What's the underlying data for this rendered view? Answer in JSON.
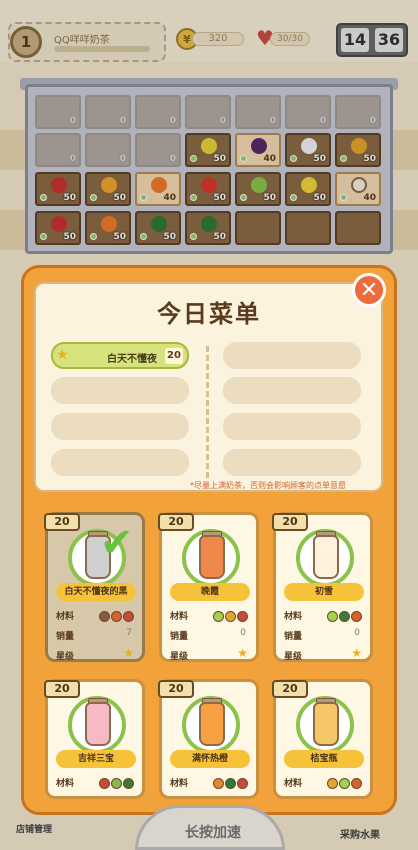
{
  "top": {
    "level": "1",
    "name": "QQ咩咩奶茶",
    "coins": "320",
    "hearts": "30/30",
    "clock_h": "14",
    "clock_m": "36"
  },
  "shelf": {
    "row1": [
      "0",
      "0",
      "0",
      "0",
      "0",
      "0",
      "0"
    ],
    "row2": [
      "0",
      "0",
      "0",
      "50",
      "40",
      "50",
      "50"
    ],
    "row3": [
      "50",
      "50",
      "40",
      "50",
      "50",
      "50",
      "40"
    ],
    "row4": [
      "50",
      "50",
      "50",
      "50"
    ]
  },
  "menu": {
    "title": "今日菜单",
    "selected_item": "白天不懂夜",
    "selected_price": "20",
    "hint": "*尽量上满奶茶，否则会影响顾客的点单意愿"
  },
  "cards": [
    {
      "price": "20",
      "name": "白天不懂夜的黑",
      "sales": "7",
      "colors": [
        "#8a5a3a",
        "#d6622e",
        "#c74a3a"
      ],
      "bottle": "#c9c9c9"
    },
    {
      "price": "20",
      "name": "晚霞",
      "sales": "0",
      "colors": [
        "#9ed34a",
        "#e3a62b",
        "#c74a3a"
      ],
      "bottle": "#f0874a"
    },
    {
      "price": "20",
      "name": "初雪",
      "sales": "0",
      "colors": [
        "#9ed34a",
        "#3a7a3a",
        "#d6622e"
      ],
      "bottle": "#fff1dd"
    },
    {
      "price": "20",
      "name": "吉祥三宝",
      "sales": "",
      "colors": [
        "#c74a3a",
        "#8ab84a",
        "#3a7a3a"
      ],
      "bottle": "#f7b9c4"
    },
    {
      "price": "20",
      "name": "满怀热橙",
      "sales": "",
      "colors": [
        "#e3872b",
        "#2e7a3a",
        "#c74a3a"
      ],
      "bottle": "#f7a043"
    },
    {
      "price": "20",
      "name": "桔宝瓶",
      "sales": "",
      "colors": [
        "#e3a62b",
        "#9ed34a",
        "#d6622e"
      ],
      "bottle": "#f6c766"
    }
  ],
  "labels": {
    "material": "材料",
    "sales": "销量",
    "level": "星级"
  },
  "bottom": {
    "left": "店铺管理",
    "mid": "长按加速",
    "right": "采购水果"
  }
}
